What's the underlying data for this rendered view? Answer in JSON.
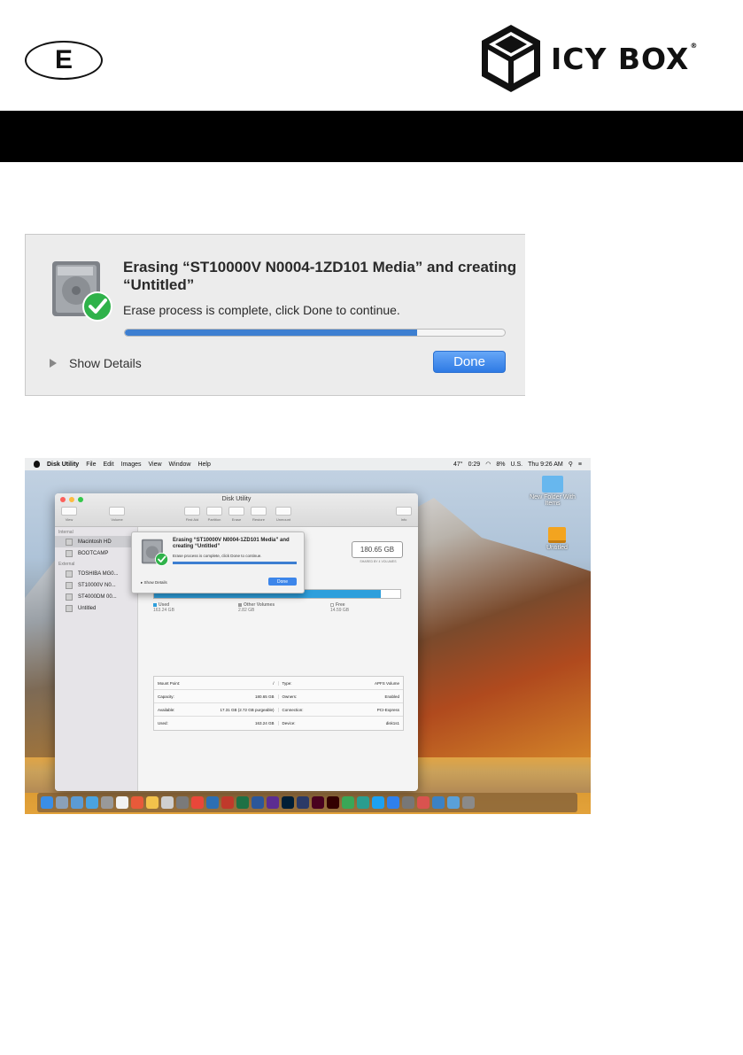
{
  "header": {
    "language_badge": "E",
    "brand_name": "ICY BOX",
    "brand_trademark": "®"
  },
  "erase_dialog": {
    "title": "Erasing “ST10000V N0004-1ZD101 Media” and creating “Untitled”",
    "message": "Erase process is complete, click Done to continue.",
    "progress_percent": 77,
    "show_details_label": "Show Details",
    "done_label": "Done",
    "icons": [
      "hard-drive-icon",
      "checkmark-icon",
      "disclosure-triangle-icon"
    ]
  },
  "desktop": {
    "menubar": {
      "app_name": "Disk Utility",
      "menus": [
        "File",
        "Edit",
        "Images",
        "View",
        "Window",
        "Help"
      ],
      "temperature": "47°",
      "clock_timer": "0:29",
      "battery": "8%",
      "input_source": "U.S.",
      "datetime": "Thu 9:26 AM"
    },
    "desktop_icons": [
      "New Folder With Items",
      "Untitled"
    ],
    "window": {
      "title": "Disk Utility",
      "toolbar": [
        "View",
        "Volume",
        "First Aid",
        "Partition",
        "Erase",
        "Restore",
        "Unmount",
        "Info"
      ],
      "sidebar": {
        "internal_header": "Internal",
        "internal_items": [
          "Macintosh HD",
          "BOOTCAMP"
        ],
        "external_header": "External",
        "external_items": [
          "TOSHIBA MG0...",
          "ST10000V N0...",
          "ST4000DM 00...",
          "Untitled"
        ]
      },
      "capacity": "180.65 GB",
      "capacity_caption": "SHARED BY 4 VOLUMES",
      "usage": [
        {
          "label": "Used",
          "value": "163.24 GB"
        },
        {
          "label": "Other Volumes",
          "value": "2.82 GB"
        },
        {
          "label": "Free",
          "value": "14.59 GB"
        }
      ],
      "info_rows": [
        {
          "k1": "Mount Point:",
          "v1": "/",
          "k2": "Type:",
          "v2": "APFS Volume"
        },
        {
          "k1": "Capacity:",
          "v1": "180.65 GB",
          "k2": "Owners:",
          "v2": "Enabled"
        },
        {
          "k1": "Available:",
          "v1": "17.31 GB (2.72 GB purgeable)",
          "k2": "Connection:",
          "v2": "PCI-Express"
        },
        {
          "k1": "Used:",
          "v1": "163.24 GB",
          "k2": "Device:",
          "v2": "disk1s1"
        }
      ],
      "sheet": {
        "title": "Erasing “ST10000V N0004-1ZD101 Media” and creating “Untitled”",
        "message": "Erase process is complete, click Done to continue.",
        "show_details_label": "Show Details",
        "done_label": "Done"
      }
    },
    "colors": {
      "accent_blue": "#3d7fd1",
      "checkmark_green": "#2fb24a",
      "usage_blue": "#2e9fdc"
    }
  }
}
